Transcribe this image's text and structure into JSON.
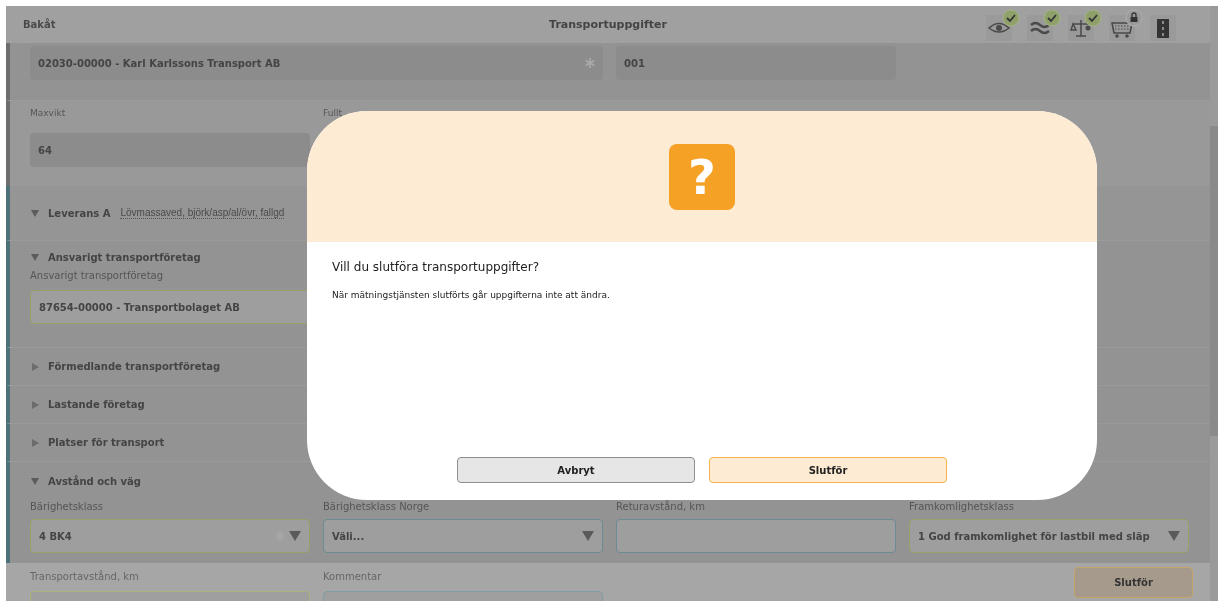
{
  "header": {
    "back": "Bakåt",
    "title": "Transportuppgifter",
    "icons": [
      {
        "kind": "eye",
        "checked": true,
        "locked": false
      },
      {
        "kind": "waves",
        "checked": true,
        "locked": false
      },
      {
        "kind": "scale",
        "checked": true,
        "locked": false
      },
      {
        "kind": "cart",
        "checked": false,
        "locked": true
      },
      {
        "kind": "road",
        "checked": false,
        "locked": false
      }
    ]
  },
  "top_fields": [
    {
      "value": "02030-00000 - Karl Karlssons Transport AB",
      "disabled": true,
      "required": true
    },
    {
      "value": "001",
      "disabled": true
    }
  ],
  "weight_fields": [
    {
      "label": "Maxvikt",
      "value": "64",
      "disabled": true
    },
    {
      "label": "Fullt"
    }
  ],
  "delivery": {
    "title": "Leverans A",
    "summary": "Lövmassaved, björk/asp/al/övr, fallgd",
    "expanded": true
  },
  "sections": [
    {
      "title": "Ansvarigt transportföretag",
      "expanded": true,
      "fields": [
        {
          "label": "Ansvarigt transportföretag",
          "value": "87654-00000 - Transportbolaget AB",
          "disabled": false,
          "valid": true
        }
      ]
    },
    {
      "title": "Förmedlande transportföretag",
      "expanded": false
    },
    {
      "title": "Lastande företag",
      "expanded": false
    },
    {
      "title": "Platser för transport",
      "expanded": false
    },
    {
      "title": "Avstånd och väg",
      "expanded": true,
      "fields": [
        {
          "label": "Bärighetsklass",
          "value": "4 BK4",
          "disabled": false,
          "valid": true,
          "required": true,
          "dropdown": true
        },
        {
          "label": "Bärighetsklass Norge",
          "value": "Väli...",
          "disabled": false,
          "valid": false,
          "dropdown": true
        },
        {
          "label": "Returavstånd, km",
          "disabled": false,
          "valid": false
        },
        {
          "label": "Framkomlighetsklass",
          "value": "1 God framkomlighet för lastbil med släp",
          "disabled": false,
          "valid": true,
          "dropdown": true
        }
      ]
    }
  ],
  "footer": {
    "fields": [
      {
        "label": "Transportavstånd, km",
        "disabled": false,
        "valid": true
      },
      {
        "label": "Kommentar",
        "disabled": false,
        "valid": false
      }
    ],
    "button": "Slutför"
  },
  "dialog": {
    "icon": "?",
    "title": "Vill du slutföra transportuppgifter?",
    "message": "När mätningstjänsten slutförts går uppgifterna inte att ändra.",
    "buttons": [
      {
        "label": "Avbryt",
        "kind": "secondary"
      },
      {
        "label": "Slutför",
        "kind": "primary"
      }
    ]
  }
}
